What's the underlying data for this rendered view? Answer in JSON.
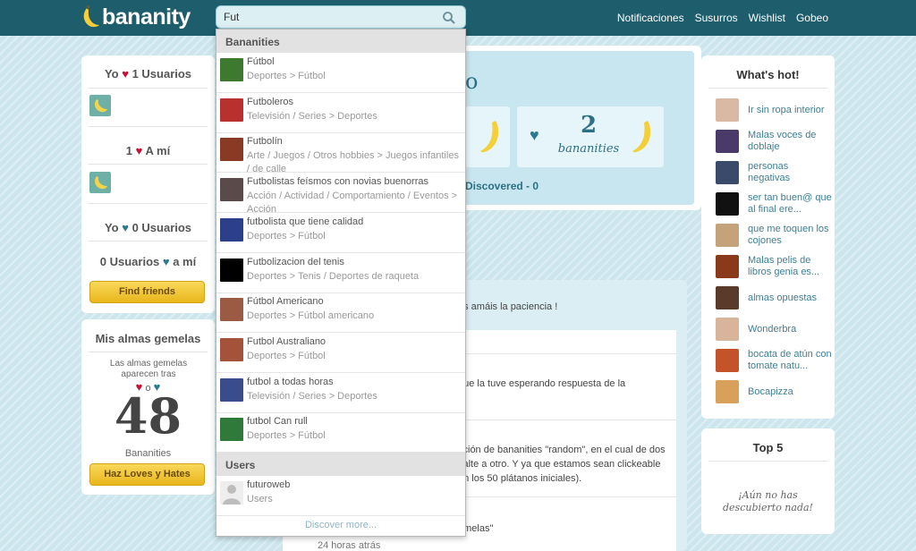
{
  "app": {
    "logo_text": "bananity",
    "brand_color": "#1e5d6c",
    "accent_yellow": "#f2c232"
  },
  "nav": {
    "items": [
      "Notificaciones",
      "Susurros",
      "Wishlist",
      "Gobeo"
    ]
  },
  "search": {
    "value": "Fut"
  },
  "left": {
    "yo_love": {
      "prefix": "Yo",
      "text": "1 Usuarios"
    },
    "love_me": {
      "prefix": "1",
      "text": "A mí"
    },
    "yo_hate": {
      "prefix": "Yo",
      "text": "0 Usuarios"
    },
    "hate_me": {
      "prefix": "0 Usuarios",
      "text": "a mí"
    },
    "find_friends": "Find friends",
    "almas": {
      "title": "Mis almas gemelas",
      "desc": "Las almas gemelas aparecen tras",
      "o": "o",
      "count": "48",
      "unit": "Bananities",
      "button": "Haz Loves y Hates"
    }
  },
  "middle": {
    "partial_letter": "o",
    "stat_count": "2",
    "stat_label": "bananities",
    "discovered": "Discovered - 0",
    "feed_line1": "os amáis la paciencia !",
    "feed_line2": "que la tuve esperando respuesta de la",
    "feed_line3a": "cción de bananities \"random\", en el cual de dos",
    "feed_line3b": "salte a otro. Y ya que estamos sean clickeable",
    "feed_line3c": "en los 50 plátanos iniciales).",
    "feed_line4": "emelas\"",
    "feed_time": "24 horas atrás"
  },
  "dropdown": {
    "section1": "Bananities",
    "section2": "Users",
    "results": [
      {
        "title": "Fútbol",
        "sub": "Deportes > Fútbol",
        "color": "#3d7a2f"
      },
      {
        "title": "Futboleros",
        "sub": "Televisión / Series > Deportes",
        "color": "#b8312f"
      },
      {
        "title": "Futbolín",
        "sub": "Arte / Juegos / Otros hobbies > Juegos infantiles / de calle",
        "color": "#8a3a24"
      },
      {
        "title": "Futbolistas feísmos con novias buenorras",
        "sub": "Acción / Actividad / Comportamiento / Eventos > Acción",
        "color": "#5a4a4a"
      },
      {
        "title": "futbolista que tiene calidad",
        "sub": "Deportes > Fútbol",
        "color": "#2b3f8a"
      },
      {
        "title": "Futbolizacion del tenis",
        "sub": "Deportes > Tenis / Deportes de raqueta",
        "color": "#000000"
      },
      {
        "title": "Fútbol Americano",
        "sub": "Deportes > Fútbol americano",
        "color": "#9b5a44"
      },
      {
        "title": "Futbol Australiano",
        "sub": "Deportes > Fútbol",
        "color": "#a4533a"
      },
      {
        "title": "futbol a todas horas",
        "sub": "Televisión / Series > Deportes",
        "color": "#3a4c8c"
      },
      {
        "title": "futbol Can rull",
        "sub": "Deportes > Fútbol",
        "color": "#2f7a3a"
      }
    ],
    "users": [
      {
        "name": "futuroweb",
        "sub": "Users"
      }
    ],
    "more": "Discover more..."
  },
  "right": {
    "hot_title": "What's hot!",
    "hot_items": [
      {
        "label": "Ir sin ropa interior",
        "color": "#d9b8a4"
      },
      {
        "label": "Malas voces de doblaje",
        "color": "#4a3a6a"
      },
      {
        "label": "personas negativas",
        "color": "#3a4a6a"
      },
      {
        "label": "ser tan buen@ que al final ere...",
        "color": "#111111"
      },
      {
        "label": "que me toquen los cojones",
        "color": "#c4a27a"
      },
      {
        "label": "Malas pelis de libros genia es...",
        "color": "#8a3a1a"
      },
      {
        "label": "almas opuestas",
        "color": "#5a3a2a"
      },
      {
        "label": "Wonderbra",
        "color": "#d8b49a"
      },
      {
        "label": "bocata de atún con tomate natu...",
        "color": "#c4532a"
      },
      {
        "label": "Bocapizza",
        "color": "#d8a05a"
      }
    ],
    "top5_title": "Top 5",
    "top5_empty": "¡Aún no has descubierto nada!"
  }
}
